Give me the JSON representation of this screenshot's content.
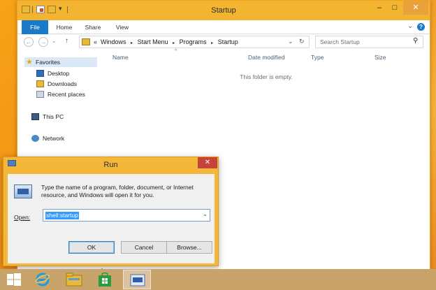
{
  "explorer": {
    "title": "Startup",
    "window_controls": {
      "minimize": "–",
      "maximize": "□",
      "close": "✕"
    },
    "ribbon": {
      "tabs": [
        "File",
        "Home",
        "Share",
        "View"
      ],
      "expand_glyph": "⌄",
      "help_glyph": "?"
    },
    "address": {
      "back_glyph": "←",
      "forward_glyph": "→",
      "history_glyph": "⌄",
      "up_glyph": "↑",
      "overflow": "«",
      "crumbs": [
        "Windows",
        "Start Menu",
        "Programs",
        "Startup"
      ],
      "separator": "▸",
      "dropdown_glyph": "⌄",
      "refresh_glyph": "↻"
    },
    "search": {
      "placeholder": "Search Startup",
      "icon_glyph": "⚲"
    },
    "nav": {
      "favorites": "Favorites",
      "favorites_items": [
        "Desktop",
        "Downloads",
        "Recent places"
      ],
      "this_pc": "This PC",
      "network": "Network"
    },
    "columns": [
      "Name",
      "Date modified",
      "Type",
      "Size"
    ],
    "sort_glyph": "^",
    "empty_message": "This folder is empty."
  },
  "run_dialog": {
    "title": "Run",
    "close_glyph": "✕",
    "description": "Type the name of a program, folder, document, or Internet resource, and Windows will open it for you.",
    "open_label": "Open:",
    "open_value": "shell:startup",
    "dropdown_glyph": "⌄",
    "buttons": {
      "ok": "OK",
      "cancel": "Cancel",
      "browse": "Browse..."
    }
  },
  "taskbar": {
    "items": [
      "start-button",
      "internet-explorer",
      "file-explorer",
      "store",
      "run"
    ]
  },
  "colors": {
    "title_bar": "#f3b531",
    "file_tab": "#1979ca",
    "close_button": "#c7423a",
    "desktop": "#f08a12",
    "taskbar": "#c9a46a",
    "selection": "#3399ff"
  }
}
